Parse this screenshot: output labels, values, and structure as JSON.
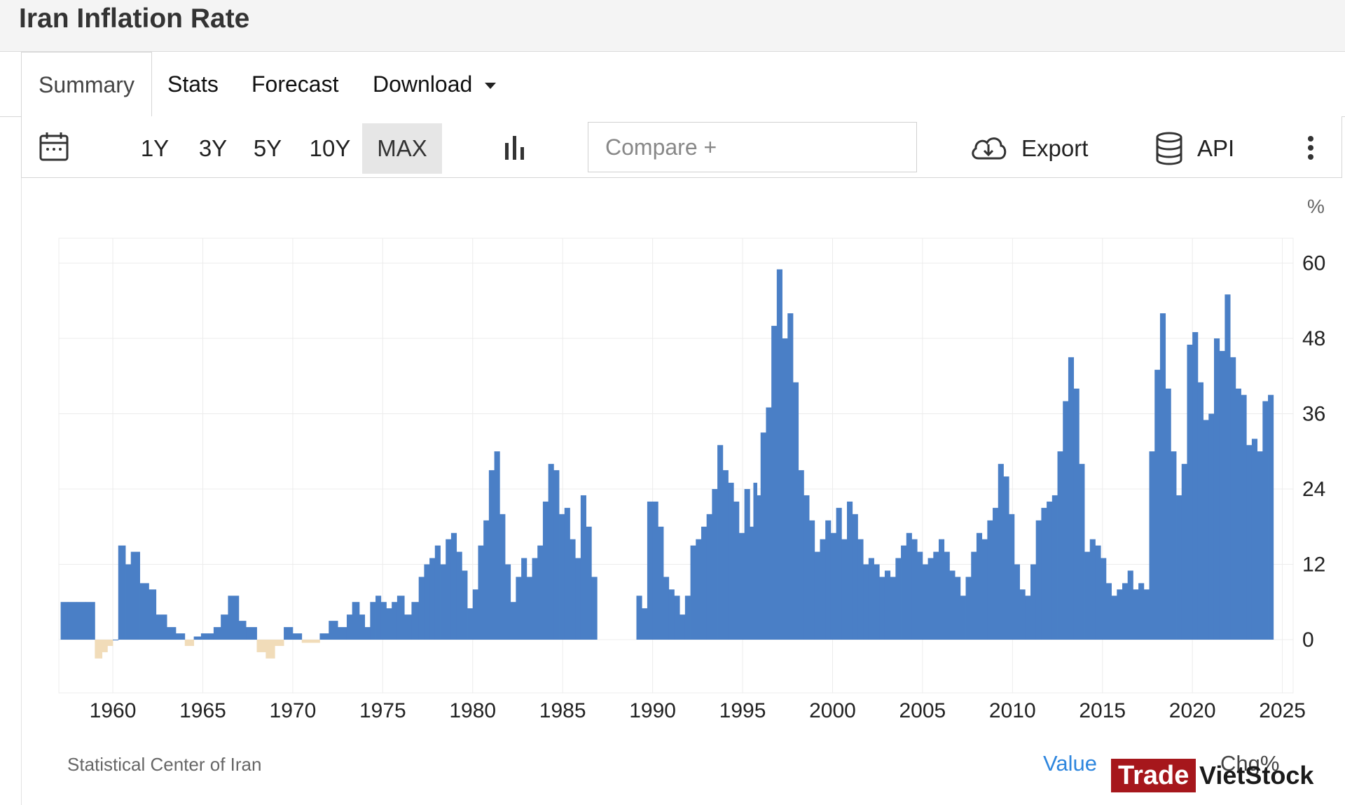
{
  "page": {
    "title": "Iran Inflation Rate"
  },
  "tabs": [
    {
      "label": "Summary",
      "active": true
    },
    {
      "label": "Stats"
    },
    {
      "label": "Forecast"
    },
    {
      "label": "Download"
    }
  ],
  "toolbar": {
    "ranges": [
      "1Y",
      "3Y",
      "5Y",
      "10Y",
      "MAX"
    ],
    "selected_range": "MAX",
    "compare_placeholder": "Compare +",
    "export_label": "Export",
    "api_label": "API",
    "icons": [
      "calendar-icon",
      "bar-chart-icon",
      "cloud-download-icon",
      "database-icon",
      "more-vert-icon"
    ]
  },
  "chart_data": {
    "type": "bar",
    "unit": "%",
    "ylim": [
      -5,
      64
    ],
    "y_ticks": [
      0,
      12,
      24,
      36,
      48,
      60
    ],
    "x_range": [
      1957,
      2025.6
    ],
    "x_ticks": [
      1960,
      1965,
      1970,
      1975,
      1980,
      1985,
      1990,
      1995,
      2000,
      2005,
      2010,
      2015,
      2020,
      2025
    ],
    "grid": true,
    "colors": {
      "positive": "#4a7fc6",
      "negative": "#f1dcb9"
    },
    "x": [
      1957.1,
      1957.5,
      1958.0,
      1958.5,
      1959.0,
      1959.4,
      1959.7,
      1960.0,
      1960.3,
      1960.7,
      1961.0,
      1961.5,
      1962.0,
      1962.4,
      1963.0,
      1963.5,
      1964.0,
      1964.5,
      1964.9,
      1965.3,
      1965.6,
      1966.0,
      1966.4,
      1967.0,
      1967.4,
      1968.0,
      1968.5,
      1969.0,
      1969.5,
      1970.0,
      1970.5,
      1971.0,
      1971.5,
      1972.0,
      1972.5,
      1973.0,
      1973.3,
      1973.7,
      1974.0,
      1974.3,
      1974.6,
      1974.9,
      1975.2,
      1975.5,
      1975.8,
      1976.2,
      1976.6,
      1977.0,
      1977.3,
      1977.6,
      1977.9,
      1978.2,
      1978.5,
      1978.8,
      1979.1,
      1979.4,
      1979.7,
      1980.0,
      1980.3,
      1980.6,
      1980.9,
      1981.2,
      1981.5,
      1981.8,
      1982.1,
      1982.4,
      1982.7,
      1983.0,
      1983.3,
      1983.6,
      1983.9,
      1984.2,
      1984.5,
      1984.8,
      1985.1,
      1985.4,
      1985.7,
      1986.0,
      1986.3,
      1986.6,
      1989.1,
      1989.4,
      1989.7,
      1990.0,
      1990.3,
      1990.6,
      1990.9,
      1991.2,
      1991.5,
      1991.8,
      1992.1,
      1992.4,
      1992.7,
      1993.0,
      1993.3,
      1993.6,
      1993.9,
      1994.2,
      1994.5,
      1994.8,
      1995.1,
      1995.4,
      1995.6,
      1995.8,
      1996.0,
      1996.3,
      1996.6,
      1996.9,
      1997.2,
      1997.5,
      1997.8,
      1998.1,
      1998.4,
      1998.7,
      1999.0,
      1999.3,
      1999.6,
      1999.9,
      2000.2,
      2000.5,
      2000.8,
      2001.1,
      2001.4,
      2001.7,
      2002.0,
      2002.3,
      2002.6,
      2002.9,
      2003.2,
      2003.5,
      2003.8,
      2004.1,
      2004.4,
      2004.7,
      2005.0,
      2005.3,
      2005.6,
      2005.9,
      2006.2,
      2006.5,
      2006.8,
      2007.1,
      2007.4,
      2007.7,
      2008.0,
      2008.3,
      2008.6,
      2008.9,
      2009.2,
      2009.5,
      2009.8,
      2010.1,
      2010.4,
      2010.7,
      2011.0,
      2011.3,
      2011.6,
      2011.9,
      2012.2,
      2012.5,
      2012.8,
      2013.1,
      2013.4,
      2013.7,
      2014.0,
      2014.3,
      2014.6,
      2014.9,
      2015.2,
      2015.5,
      2015.8,
      2016.1,
      2016.4,
      2016.7,
      2017.0,
      2017.3,
      2017.6,
      2017.9,
      2018.2,
      2018.5,
      2018.8,
      2019.1,
      2019.4,
      2019.7,
      2020.0,
      2020.3,
      2020.6,
      2020.9,
      2021.2,
      2021.5,
      2021.8,
      2022.1,
      2022.4,
      2022.7,
      2023.0,
      2023.3,
      2023.6,
      2023.9,
      2024.2,
      2024.5,
      2024.8,
      2025.1,
      2025.4
    ],
    "values": [
      6,
      6,
      6,
      6,
      -3,
      -2,
      -1,
      0,
      15,
      12,
      14,
      9,
      8,
      4,
      2,
      1,
      -1,
      0.5,
      1,
      1,
      2,
      4,
      7,
      3,
      2,
      -2,
      -3,
      -1,
      2,
      1,
      -0.5,
      -0.5,
      1,
      3,
      2,
      4,
      6,
      4,
      2,
      6,
      7,
      6,
      5,
      6,
      7,
      4,
      6,
      10,
      12,
      13,
      15,
      12,
      16,
      17,
      14,
      11,
      5,
      8,
      15,
      19,
      27,
      30,
      20,
      12,
      6,
      10,
      13,
      10,
      13,
      15,
      22,
      28,
      27,
      20,
      21,
      16,
      13,
      23,
      18,
      10,
      7,
      5,
      22,
      22,
      18,
      10,
      8,
      7,
      4,
      7,
      15,
      16,
      18,
      20,
      24,
      31,
      27,
      25,
      22,
      17,
      24,
      18,
      25,
      23,
      33,
      37,
      50,
      59,
      48,
      52,
      41,
      27,
      23,
      19,
      14,
      16,
      19,
      17,
      21,
      16,
      22,
      20,
      16,
      12,
      13,
      12,
      10,
      11,
      10,
      13,
      15,
      17,
      16,
      14,
      12,
      13,
      14,
      16,
      14,
      11,
      10,
      7,
      10,
      14,
      17,
      16,
      19,
      21,
      28,
      26,
      20,
      12,
      8,
      7,
      12,
      19,
      21,
      22,
      23,
      30,
      38,
      45,
      40,
      28,
      14,
      16,
      15,
      13,
      9,
      7,
      8,
      9,
      11,
      8,
      9,
      8,
      30,
      43,
      52,
      40,
      30,
      23,
      28,
      47,
      49,
      41,
      35,
      36,
      48,
      46,
      55,
      45,
      40,
      39,
      31,
      32,
      30,
      38,
      39
    ]
  },
  "footer": {
    "source": "Statistical Center of Iran",
    "value_label": "Value",
    "chg_label": "Chg%",
    "watermark_trade": "Trade",
    "watermark_viet": "VietStock"
  }
}
